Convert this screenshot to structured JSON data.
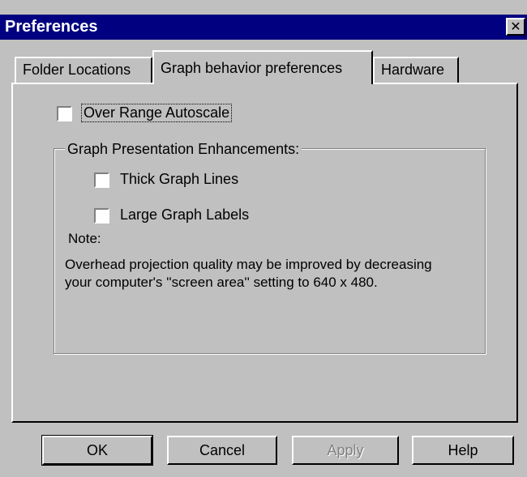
{
  "window": {
    "title": "Preferences",
    "close_glyph": "✕"
  },
  "tabs": [
    {
      "label": "Folder Locations",
      "active": false
    },
    {
      "label": "Graph behavior preferences",
      "active": true
    },
    {
      "label": "Hardware",
      "active": false
    }
  ],
  "graph_tab": {
    "autoscale": {
      "label": "Over Range Autoscale",
      "checked": false
    },
    "group": {
      "legend": "Graph Presentation Enhancements:",
      "thick_lines": {
        "label": "Thick Graph Lines",
        "checked": false
      },
      "large_labels": {
        "label": "Large Graph Labels",
        "checked": false
      },
      "note_label": "Note:",
      "note_text": "Overhead projection quality may be improved by decreasing your computer's ''screen area'' setting to 640 x 480."
    }
  },
  "buttons": {
    "ok": "OK",
    "cancel": "Cancel",
    "apply": "Apply",
    "help": "Help"
  }
}
